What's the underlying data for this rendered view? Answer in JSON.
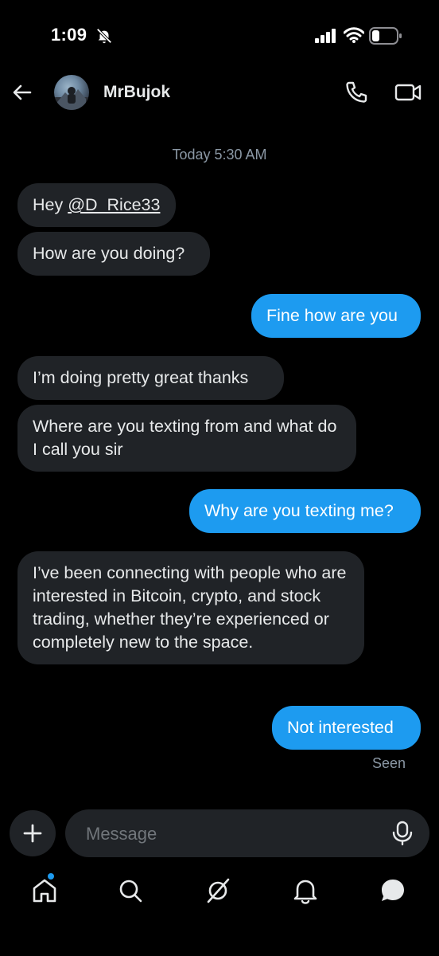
{
  "status_bar": {
    "time": "1:09"
  },
  "header": {
    "contact_name": "MrBujok"
  },
  "thread": {
    "timestamp": "Today 5:30 AM",
    "messages": [
      {
        "from": "them",
        "prefix": "Hey ",
        "mention": "@D_Rice33"
      },
      {
        "from": "them",
        "text": "How are you doing?"
      },
      {
        "from": "me",
        "text": "Fine how are you"
      },
      {
        "from": "them",
        "text": "I’m doing pretty great thanks"
      },
      {
        "from": "them",
        "text": "Where are you texting from and what do I call you sir"
      },
      {
        "from": "me",
        "text": "Why are you texting me?"
      },
      {
        "from": "them",
        "text": "I’ve been connecting with people who are interested in Bitcoin, crypto, and stock trading, whether they’re experienced or completely new to the space."
      },
      {
        "from": "me",
        "text": "Not interested"
      }
    ],
    "seen_label": "Seen"
  },
  "composer": {
    "placeholder": "Message"
  },
  "nav": {
    "tabs": [
      "home-icon",
      "search-icon",
      "grok-icon",
      "notifications-icon",
      "messages-icon"
    ]
  },
  "colors": {
    "accent": "#1d9bf0",
    "incoming_bubble": "#202327",
    "background": "#000000"
  }
}
